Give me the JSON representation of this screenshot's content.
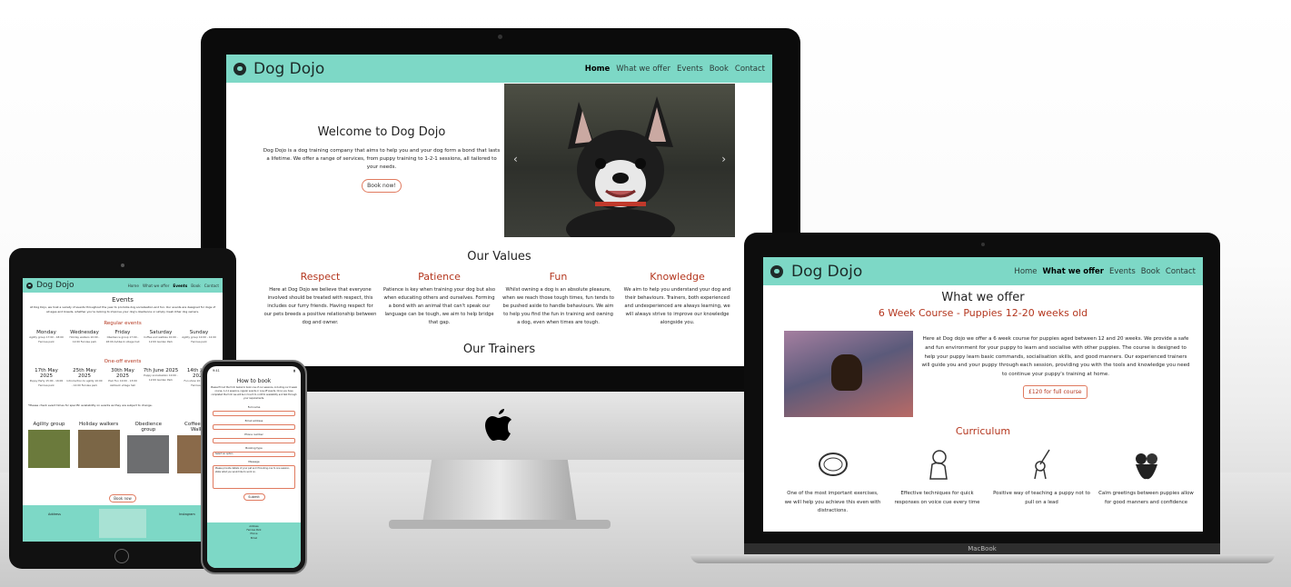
{
  "site": {
    "brand": "Dog Dojo",
    "nav": [
      "Home",
      "What we offer",
      "Events",
      "Book",
      "Contact"
    ]
  },
  "imac": {
    "active_nav": "Home",
    "hero": {
      "title": "Welcome to Dog Dojo",
      "text": "Dog Dojo is a dog training company that aims to help you and your dog form a bond that lasts a lifetime. We offer a range of services, from puppy training to 1-2-1 sessions, all tailored to your needs.",
      "button": "Book now!"
    },
    "values_title": "Our Values",
    "values": [
      {
        "title": "Respect",
        "text": "Here at Dog Dojo we believe that everyone involved should be treated with respect, this includes our furry friends. Having respect for our pets breeds a positive relationship between dog and owner."
      },
      {
        "title": "Patience",
        "text": "Patience is key when training your dog but also when educating others and ourselves. Forming a bond with an animal that can't speak our language can be tough, we aim to help bridge that gap."
      },
      {
        "title": "Fun",
        "text": "Whilst owning a dog is an absolute pleasure, when we reach those tough times, fun tends to be pushed aside to handle behaviours. We aim to help you find the fun in training and owning a dog, even when times are tough."
      },
      {
        "title": "Knowledge",
        "text": "We aim to help you understand your dog and their behaviours. Trainers, both experienced and undexperienced are always learning, we will always strive to improve our knowledge alongside you."
      }
    ],
    "trainers_title": "Our Trainers"
  },
  "macbook": {
    "active_nav": "What we offer",
    "label": "MacBook",
    "title": "What we offer",
    "subtitle": "6 Week Course - Puppies 12-20 weeks old",
    "text": "Here at Dog dojo we offer a 6 week course for puppies aged between 12 and 20 weeks. We provide a safe and fun environment for your puppy to learn and socialise with other puppies. The course is designed to help your puppy learn basic commands, socialisation skills, and good manners. Our experienced trainers will guide you and your puppy through each session, providing you with the tools and knowledge you need to continue your puppy's training at home.",
    "button": "£120 for full course",
    "curriculum_title": "Curriculum",
    "curriculum": [
      {
        "icon": "dog-collar-icon",
        "text": "One of the most important exercises, we will help you achieve this even with distractions."
      },
      {
        "icon": "sitting-puppy-icon",
        "text": "Effective techniques for quick responses on voice cue every time"
      },
      {
        "icon": "dog-on-lead-icon",
        "text": "Positive way of teaching a puppy not to pull on a lead"
      },
      {
        "icon": "dogs-greeting-icon",
        "text": "Calm greetings between puppies allow for good manners and confidence"
      }
    ]
  },
  "tablet": {
    "active_nav": "Events",
    "title": "Events",
    "intro": "At Dog Dojo, we host a variety of events throughout the year to promote dog socialisation and fun. Our events are designed for dogs of all ages and breeds, whether you're looking to improve your dog's obedience or simply meet other dog owners.",
    "regular_title": "Regular events",
    "regular": [
      {
        "day": "Monday",
        "detail": "Agility group 17:00 - 18:00 Fernlea park"
      },
      {
        "day": "Wednesday",
        "detail": "Holiday walkers 10:00 - 12:00 Fernlea park"
      },
      {
        "day": "Friday",
        "detail": "Obedience group 17:00 - 18:00 Ashbeck village hall"
      },
      {
        "day": "Saturday",
        "detail": "Coffee and waltzes 10:00 - 12:00 Garden Park"
      },
      {
        "day": "Sunday",
        "detail": "Agility group 10:00 - 12:00 Fernlea park"
      }
    ],
    "oneoff_title": "One-off events",
    "oneoff": [
      {
        "day": "17th May 2025",
        "detail": "Puppy Party 15:00 - 16:00 Fernlea park"
      },
      {
        "day": "25th May 2025",
        "detail": "Introduction to agility 10:00 - 12:00 Fernlea park"
      },
      {
        "day": "30th May 2025",
        "detail": "Pool Fun 10:00 - 13:00 Ashbeck village hall"
      },
      {
        "day": "7th June 2025",
        "detail": "Puppy socialisation 10:00 - 12:00 Garden Park"
      },
      {
        "day": "14th June 2025",
        "detail": "Fun show 10:00 - 15:00 Fernlea park"
      }
    ],
    "note": "*Please check event times for specific availability on events as they are subject to change.",
    "groups": [
      "Agility group",
      "Holiday walkers",
      "Obedience group",
      "Coffee and Walks"
    ],
    "button": "Book now",
    "footer_left": "Address",
    "footer_right": "Instagram"
  },
  "phone": {
    "time": "9:41",
    "title": "How to book",
    "intro": "Please fill out the form below to book one of our sessions, including our 6 week course, 1-2-1 sessions, regular events or one-off events. Once you have completed the form we will be in touch to confirm availability and talk through your requirements.",
    "labels": [
      "Full name",
      "Email address",
      "Phone number",
      "Booking type",
      "Message"
    ],
    "select_placeholder": "Select an option",
    "message_placeholder": "Please provide details of your pet and if booking one to one session, state what you would like to work on.",
    "submit": "Submit",
    "footer": [
      "Address",
      "Fernlea Park",
      "Phone",
      "Email"
    ]
  }
}
